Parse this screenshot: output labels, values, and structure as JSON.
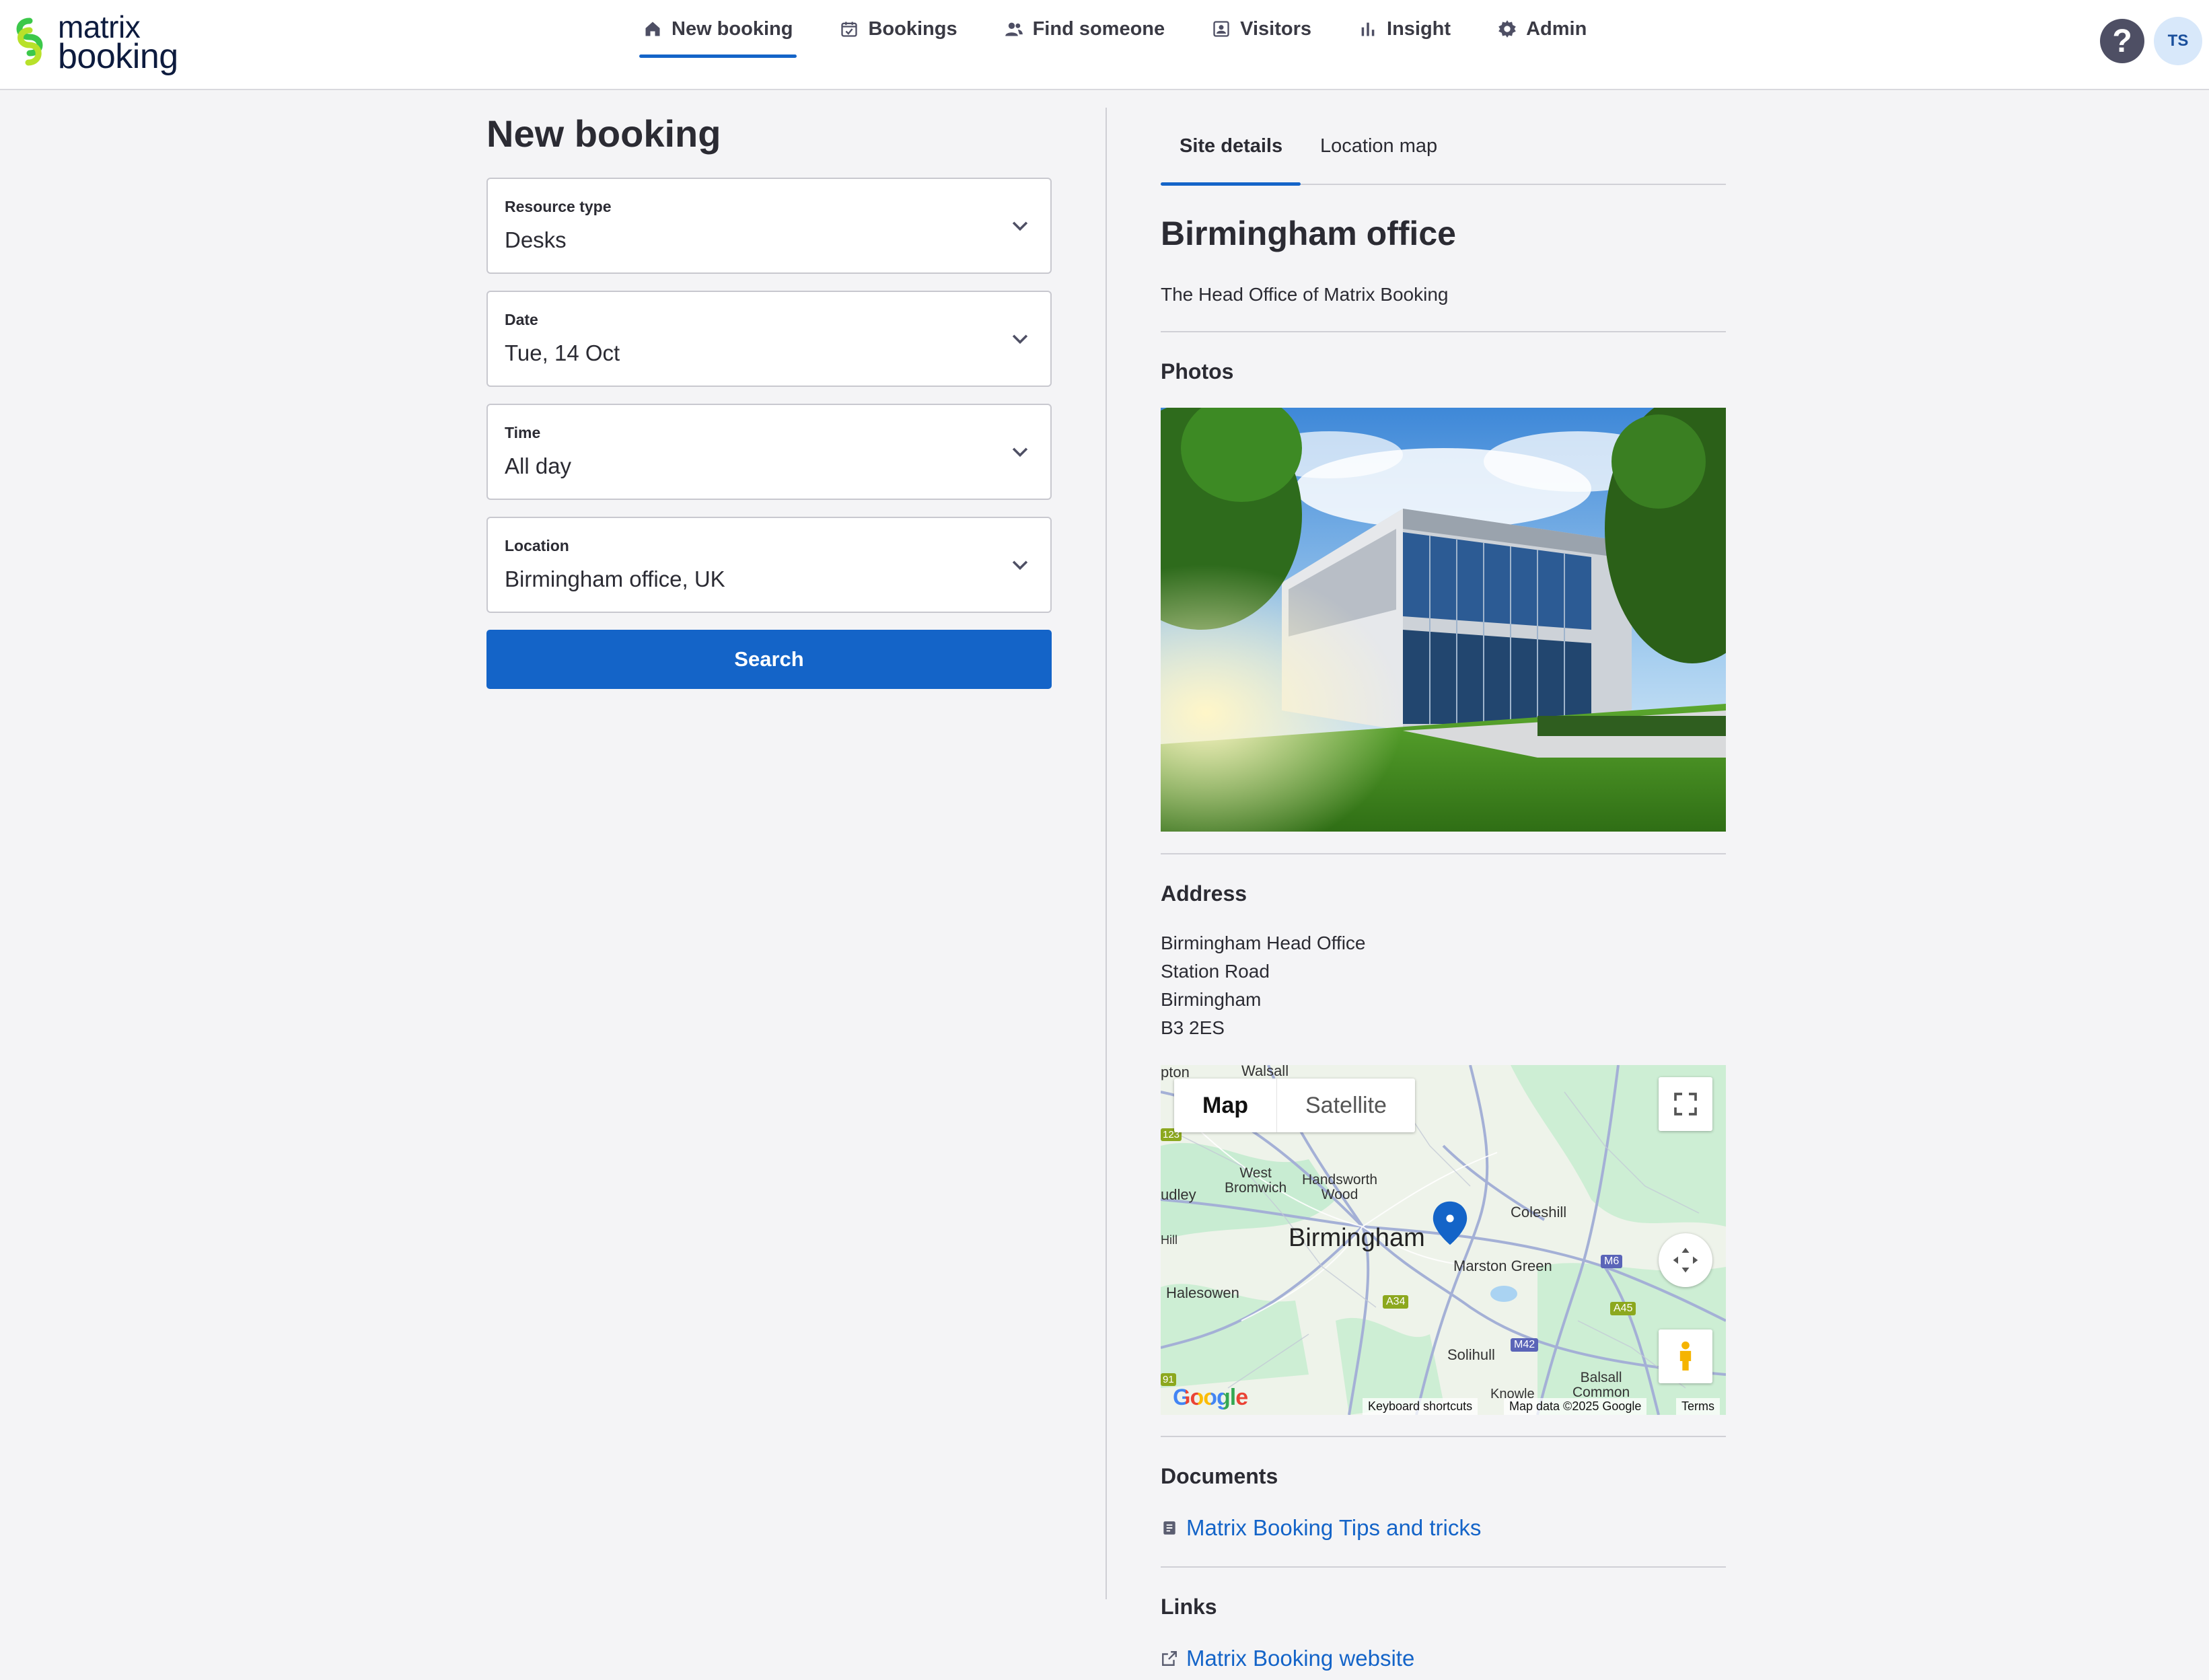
{
  "brand": {
    "name_line1": "matrix",
    "name_line2": "booking"
  },
  "nav": {
    "items": [
      {
        "label": "New booking",
        "icon": "home-icon",
        "active": true
      },
      {
        "label": "Bookings",
        "icon": "calendar-check-icon",
        "active": false
      },
      {
        "label": "Find someone",
        "icon": "people-icon",
        "active": false
      },
      {
        "label": "Visitors",
        "icon": "visitor-badge-icon",
        "active": false
      },
      {
        "label": "Insight",
        "icon": "bar-chart-icon",
        "active": false
      },
      {
        "label": "Admin",
        "icon": "gear-icon",
        "active": false
      }
    ],
    "help_label": "?",
    "avatar_initials": "TS"
  },
  "booking": {
    "title": "New booking",
    "fields": [
      {
        "label": "Resource type",
        "value": "Desks"
      },
      {
        "label": "Date",
        "value": "Tue, 14 Oct"
      },
      {
        "label": "Time",
        "value": "All day"
      },
      {
        "label": "Location",
        "value": "Birmingham office, UK"
      }
    ],
    "search_label": "Search"
  },
  "site": {
    "tabs": [
      {
        "label": "Site details",
        "active": true
      },
      {
        "label": "Location map",
        "active": false
      }
    ],
    "title": "Birmingham office",
    "description": "The Head Office of Matrix Booking",
    "photos_heading": "Photos",
    "address_heading": "Address",
    "address_lines": [
      "Birmingham Head Office",
      "Station Road",
      "Birmingham",
      "B3 2ES"
    ],
    "map": {
      "toggle_map": "Map",
      "toggle_satellite": "Satellite",
      "labels": {
        "walsall": "Walsall",
        "pton": "pton",
        "west_bromwich": "West\nBromwich",
        "handsworth_wood": "Handsworth\nWood",
        "udley": "udley",
        "hill": "Hill",
        "birmingham": "Birmingham",
        "coleshill": "Coleshill",
        "marston_green": "Marston Green",
        "halesowen": "Halesowen",
        "solihull": "Solihull",
        "balsall_common": "Balsall\nCommon",
        "knowle": "Knowle"
      },
      "road_badges": {
        "m6": "M6",
        "a34": "A34",
        "a45": "A45",
        "m42": "M42",
        "r123": "123",
        "r91": "91"
      },
      "google": "Google",
      "footer_shortcuts": "Keyboard shortcuts",
      "footer_data": "Map data ©2025 Google",
      "footer_terms": "Terms",
      "marker_color": "#1464c8"
    },
    "documents_heading": "Documents",
    "document_link": "Matrix Booking Tips and tricks",
    "links_heading": "Links",
    "website_link": "Matrix Booking website"
  },
  "colors": {
    "accent": "#1464c8",
    "logo_green": "#3cc84a",
    "logo_lime": "#b8e12a",
    "help_bg": "#4e4f64",
    "avatar_bg": "#d8e8fa"
  }
}
